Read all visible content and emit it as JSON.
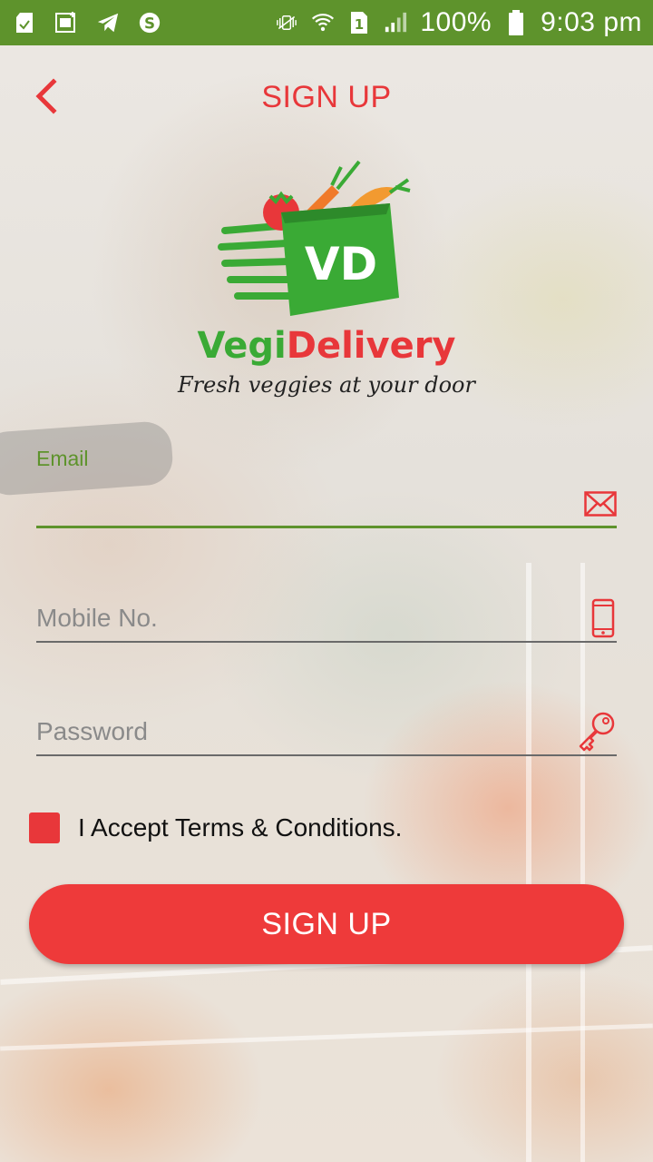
{
  "status_bar": {
    "battery_percent": "100%",
    "time": "9:03 pm",
    "sim_slot": "1",
    "icons": [
      "sd-card-icon",
      "gallery-notification-icon",
      "telegram-icon",
      "skype-icon",
      "vibrate-icon",
      "wifi-icon",
      "sim-icon",
      "signal-icon",
      "battery-icon"
    ]
  },
  "header": {
    "title": "SIGN UP",
    "back_icon": "chevron-left-icon"
  },
  "logo": {
    "badge_text": "VD",
    "brand_part1": "Vegi",
    "brand_part2": "Delivery",
    "tagline": "Fresh veggies at your door"
  },
  "form": {
    "email": {
      "label": "Email",
      "value": "",
      "icon": "envelope-icon"
    },
    "mobile": {
      "placeholder": "Mobile No.",
      "value": "",
      "icon": "mobile-phone-icon"
    },
    "password": {
      "placeholder": "Password",
      "value": "",
      "icon": "key-icon"
    },
    "terms_label": "I Accept Terms & Conditions.",
    "submit_label": "SIGN UP"
  },
  "colors": {
    "status_bar": "#5e932c",
    "accent_red": "#e8373a",
    "accent_green": "#5e932c",
    "logo_green": "#3aaa35"
  }
}
